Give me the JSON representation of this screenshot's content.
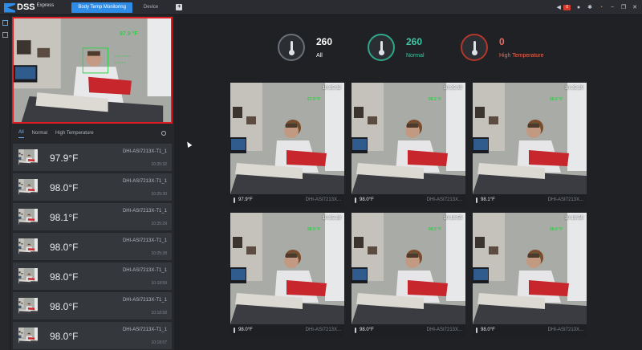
{
  "app": {
    "name": "DSS",
    "subtitle": "Express"
  },
  "tabs": [
    {
      "label": "Body Temp Monitoring"
    },
    {
      "label": "Device"
    }
  ],
  "tab_add_label": "+",
  "alarm_count": "0",
  "stats": [
    {
      "value": "260",
      "label": "All",
      "color": "#ffffff",
      "ring": "#6b7077"
    },
    {
      "value": "260",
      "label": "Normal",
      "color": "#3fc7a6",
      "ring": "#2fa88a"
    },
    {
      "value": "0",
      "label": "High Temperature",
      "color": "#ee6a57",
      "ring": "#b2372d"
    }
  ],
  "live_overlay_temp": "97.9 °F",
  "filter_tabs": [
    "All",
    "Normal",
    "High Temperature"
  ],
  "records": [
    {
      "temp": "97.9°F",
      "device": "DHI-ASI7213X-T1_1",
      "time": "10:25:32"
    },
    {
      "temp": "98.0°F",
      "device": "DHI-ASI7213X-T1_1",
      "time": "10:25:30"
    },
    {
      "temp": "98.1°F",
      "device": "DHI-ASI7213X-T1_1",
      "time": "10:25:29"
    },
    {
      "temp": "98.0°F",
      "device": "DHI-ASI7213X-T1_1",
      "time": "10:25:28"
    },
    {
      "temp": "98.0°F",
      "device": "DHI-ASI7213X-T1_1",
      "time": "10:18:59"
    },
    {
      "temp": "98.0°F",
      "device": "DHI-ASI7213X-T1_1",
      "time": "10:18:58"
    },
    {
      "temp": "98.0°F",
      "device": "DHI-ASI7213X-T1_1",
      "time": "10:18:57"
    }
  ],
  "snapshots": [
    {
      "time": "10:25:32",
      "overlay": "97.9 °F",
      "temp": "97.9°F",
      "device": "DHI-ASI7213X..."
    },
    {
      "time": "10:25:30",
      "overlay": "98.1 °F",
      "temp": "98.0°F",
      "device": "DHI-ASI7213X..."
    },
    {
      "time": "10:25:29",
      "overlay": "98.0 °F",
      "temp": "98.1°F",
      "device": "DHI-ASI7213X..."
    },
    {
      "time": "10:25:28",
      "overlay": "98.0 °F",
      "temp": "98.0°F",
      "device": "DHI-ASI7213X..."
    },
    {
      "time": "10:18:59",
      "overlay": "98.0 °F",
      "temp": "98.0°F",
      "device": "DHI-ASI7213X..."
    },
    {
      "time": "10:18:58",
      "overlay": "98.0 °F",
      "temp": "98.0°F",
      "device": "DHI-ASI7213X..."
    }
  ],
  "icons": {
    "volume": "speaker-icon",
    "user": "user-icon",
    "settings": "gear-icon",
    "alarm": "alarm-icon",
    "minimize": "minimize-icon",
    "restore": "restore-icon",
    "close": "close-icon",
    "filter_settings": "location-pin-icon"
  },
  "colors": {
    "accent": "#2d8ce8",
    "live_border": "#e11c22",
    "normal": "#3fc7a6",
    "high": "#ee6a57"
  }
}
